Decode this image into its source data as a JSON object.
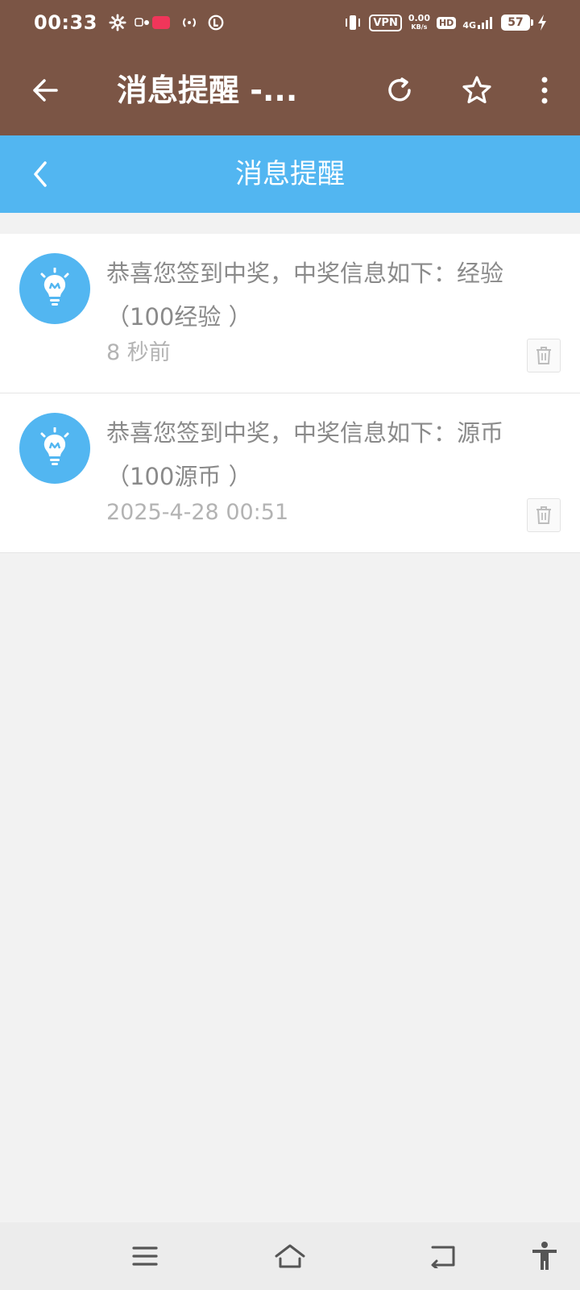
{
  "status_bar": {
    "time": "00:33",
    "vpn_label": "VPN",
    "net_speed_value": "0.00",
    "net_speed_unit": "KB/s",
    "hd_label": "HD",
    "network_label": "4G",
    "battery_level": "57"
  },
  "browser": {
    "title": "消息提醒 -..."
  },
  "app_header": {
    "title": "消息提醒"
  },
  "messages": [
    {
      "text": "恭喜您签到中奖，中奖信息如下：经验（100经验 ）",
      "time": "8 秒前"
    },
    {
      "text": "恭喜您签到中奖，中奖信息如下：源币（100源币 ）",
      "time": "2025-4-28 00:51"
    }
  ],
  "colors": {
    "browser_bar": "#7b5545",
    "app_header": "#52b6f1",
    "avatar_bg": "#52b6f1",
    "message_text": "#8a8a8a",
    "time_text": "#b3b3b3",
    "background": "#f2f2f2"
  },
  "icons": {
    "browser_back": "arrow-left-icon",
    "refresh": "refresh-icon",
    "star": "star-icon",
    "more": "more-vertical-icon",
    "app_back": "chevron-left-icon",
    "avatar": "lightbulb-icon",
    "delete": "trash-icon",
    "nav_menu": "menu-icon",
    "nav_home": "home-icon",
    "nav_back": "back-icon",
    "nav_access": "accessibility-icon"
  }
}
